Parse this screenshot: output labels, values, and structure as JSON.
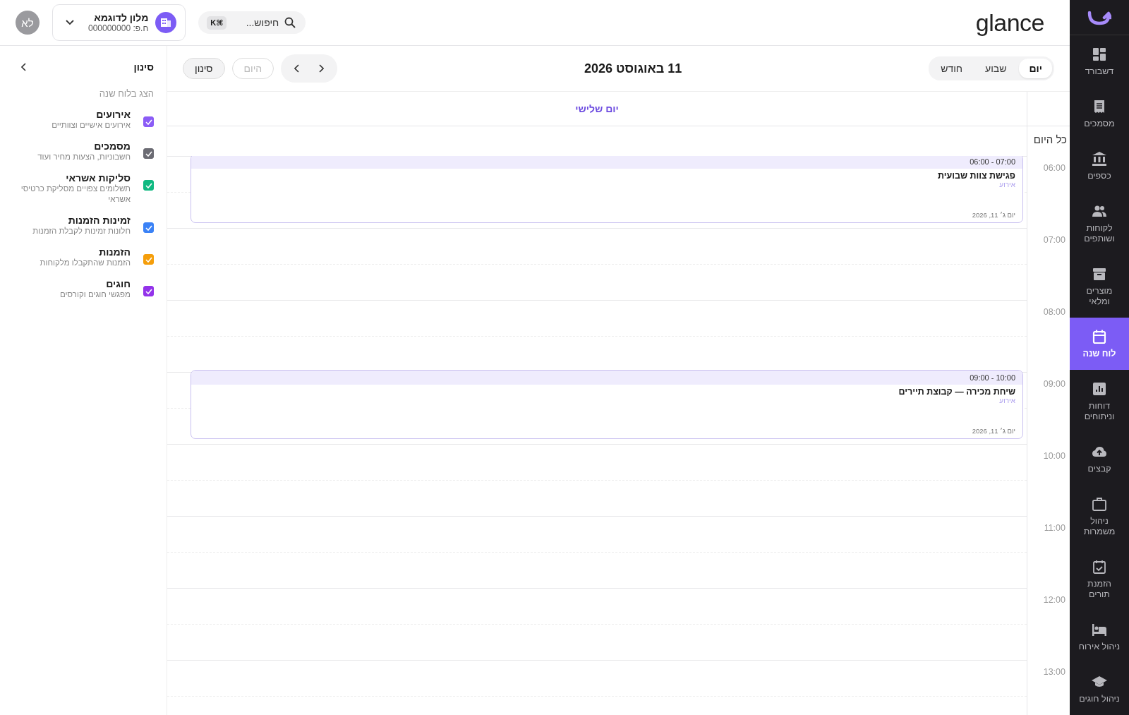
{
  "sidebar": {
    "items": [
      {
        "label": "דשבורד",
        "selected": false
      },
      {
        "label": "מסמכים",
        "selected": false
      },
      {
        "label": "כספים",
        "selected": false
      },
      {
        "label": "לקוחות ושותפים",
        "selected": false
      },
      {
        "label": "מוצרים ומלאי",
        "selected": false
      },
      {
        "label": "לוח שנה",
        "selected": true
      },
      {
        "label": "דוחות וניתוחים",
        "selected": false
      },
      {
        "label": "קבצים",
        "selected": false
      },
      {
        "label": "ניהול משמרות",
        "selected": false
      },
      {
        "label": "הזמנת תורים",
        "selected": false
      },
      {
        "label": "ניהול אירוח",
        "selected": false
      },
      {
        "label": "ניהול חוגים",
        "selected": false
      }
    ]
  },
  "topbar": {
    "logo": "glance",
    "search": {
      "placeholder": "חיפוש...",
      "shortcut": "⌘K"
    },
    "company": {
      "name": "מלון לדוגמא",
      "id": "ח.פ: 000000000"
    },
    "avatar": "לא"
  },
  "calendar": {
    "views": [
      {
        "label": "יום",
        "selected": true
      },
      {
        "label": "שבוע",
        "selected": false
      },
      {
        "label": "חודש",
        "selected": false
      }
    ],
    "title": "11 באוגוסט 2026",
    "today_button": {
      "label": "היום",
      "disabled": true
    },
    "filter_button": "סינון",
    "day_header": "יום שלישי",
    "all_day_label": "כל היום",
    "hours": [
      {
        "label": "06:00",
        "events": [
          {
            "time": "07:00 - 06:00",
            "title": "פגישת צוות שבועית",
            "kind": "אירוע",
            "date": "יום ג׳ 11, 2026"
          }
        ]
      },
      {
        "label": "07:00"
      },
      {
        "label": "08:00"
      },
      {
        "label": "09:00",
        "events": [
          {
            "time": "10:00 - 09:00",
            "title": "שיחת מכירה — קבוצת תיירים",
            "kind": "אירוע",
            "date": "יום ג׳ 11, 2026"
          }
        ]
      },
      {
        "label": "10:00"
      },
      {
        "label": "11:00"
      },
      {
        "label": "12:00"
      },
      {
        "label": "13:00"
      }
    ]
  },
  "filter": {
    "title": "סינון",
    "subtitle": "הצג בלוח שנה",
    "items": [
      {
        "label": "אירועים",
        "description": "אירועים אישיים וצוותיים",
        "checked": true,
        "color": "#8b5cf6"
      },
      {
        "label": "מסמכים",
        "description": "חשבוניות, הצעות מחיר ועוד",
        "checked": true,
        "color": "#6b6b73"
      },
      {
        "label": "סליקות אשראי",
        "description": "תשלומים צפויים מסליקת כרטיסי אשראי",
        "checked": true,
        "color": "#10b981"
      },
      {
        "label": "זמינות הזמנות",
        "description": "חלונות זמינות לקבלת הזמנות",
        "checked": true,
        "color": "#3b82f6"
      },
      {
        "label": "הזמנות",
        "description": "הזמנות שהתקבלו מלקוחות",
        "checked": true,
        "color": "#f59e0b"
      },
      {
        "label": "חוגים",
        "description": "מפגשי חוגים וקורסים",
        "checked": true,
        "color": "#9333ea"
      }
    ]
  }
}
